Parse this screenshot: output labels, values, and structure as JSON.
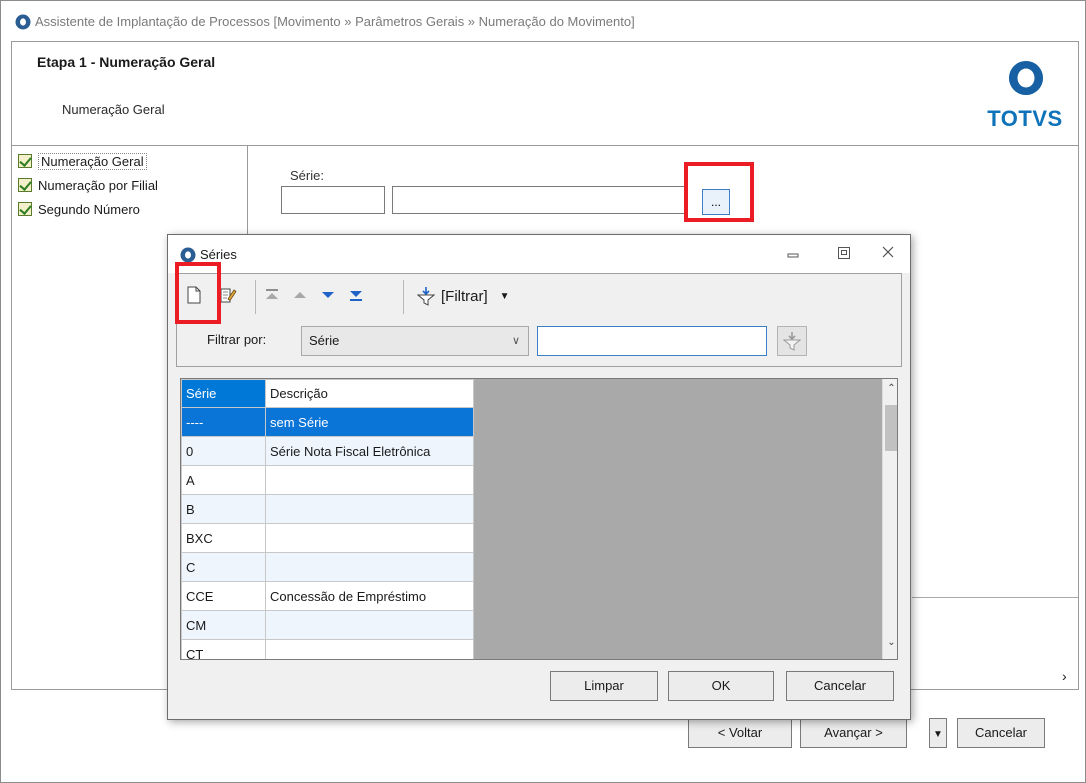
{
  "window": {
    "title": "Assistente de Implantação de Processos [Movimento » Parâmetros Gerais » Numeração do Movimento]"
  },
  "header": {
    "step_title": "Etapa 1 - Numeração Geral",
    "step_subtitle": "Numeração Geral",
    "logo_text": "TOTVS"
  },
  "tree": {
    "items": [
      {
        "label": "Numeração Geral",
        "selected": true
      },
      {
        "label": "Numeração por Filial",
        "selected": false
      },
      {
        "label": "Segundo Número",
        "selected": false
      }
    ]
  },
  "form": {
    "serie_label": "Série:",
    "serie_code_value": "",
    "serie_desc_value": "",
    "lookup_button_label": "..."
  },
  "wizard_footer": {
    "back_label": "< Voltar",
    "next_label": "Avançar >",
    "cancel_label": "Cancelar"
  },
  "dialog": {
    "title": "Séries",
    "toolbar": {
      "filter_button_label": "[Filtrar]"
    },
    "filter": {
      "by_label": "Filtrar por:",
      "field_selected": "Série",
      "value": ""
    },
    "grid": {
      "columns": [
        "Série",
        "Descrição"
      ],
      "rows": [
        {
          "serie": "----",
          "descricao": "sem Série",
          "selected": true
        },
        {
          "serie": "0",
          "descricao": "Série Nota Fiscal Eletrônica",
          "selected": false
        },
        {
          "serie": "A",
          "descricao": "",
          "selected": false
        },
        {
          "serie": "B",
          "descricao": "",
          "selected": false
        },
        {
          "serie": "BXC",
          "descricao": "",
          "selected": false
        },
        {
          "serie": "C",
          "descricao": "",
          "selected": false
        },
        {
          "serie": "CCE",
          "descricao": "Concessão de Empréstimo",
          "selected": false
        },
        {
          "serie": "CM",
          "descricao": "",
          "selected": false
        },
        {
          "serie": "CT",
          "descricao": "",
          "selected": false
        }
      ]
    },
    "buttons": {
      "clear_label": "Limpar",
      "ok_label": "OK",
      "cancel_label": "Cancelar"
    }
  },
  "colors": {
    "accent": "#0078d7",
    "highlight_red": "#ec1c24",
    "totvs_blue": "#0f73b9"
  }
}
